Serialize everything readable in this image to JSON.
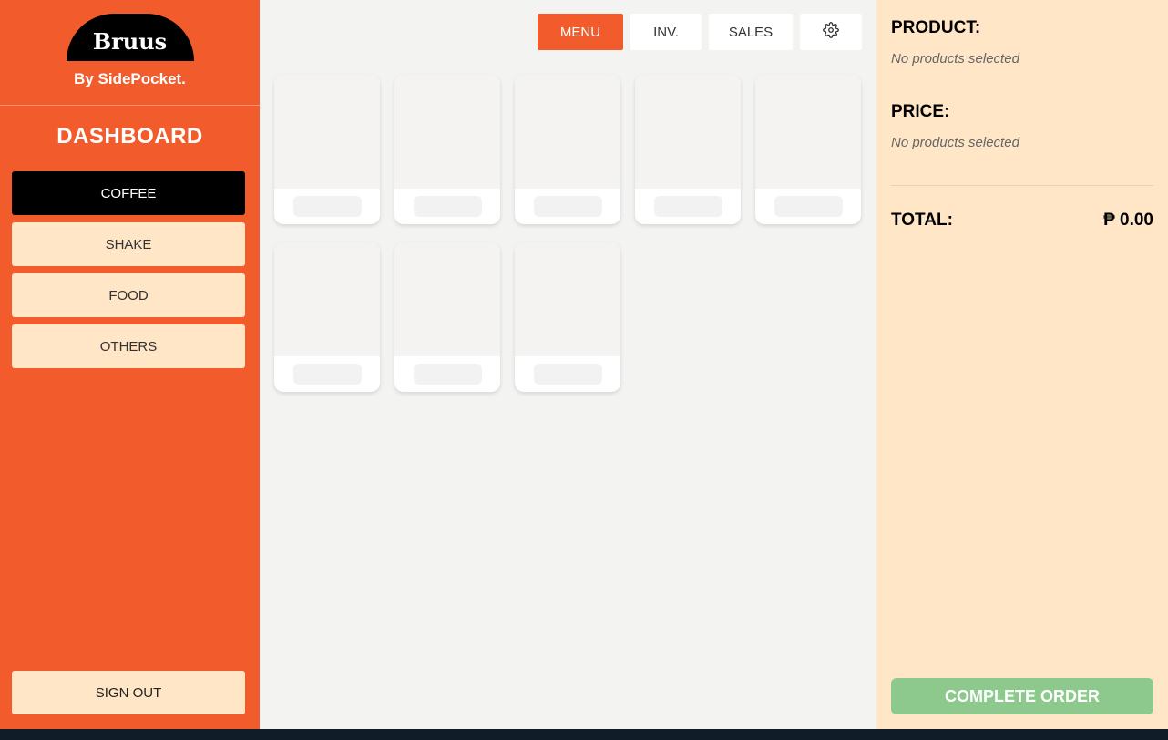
{
  "brand": {
    "name": "Bruus",
    "tagline": "By SidePocket."
  },
  "sidebar": {
    "title": "DASHBOARD",
    "categories": [
      {
        "label": "COFFEE",
        "active": true
      },
      {
        "label": "SHAKE",
        "active": false
      },
      {
        "label": "FOOD",
        "active": false
      },
      {
        "label": "OTHERS",
        "active": false
      }
    ],
    "sign_out": "SIGN OUT"
  },
  "topnav": {
    "menu": "MENU",
    "inventory": "INV.",
    "sales": "SALES",
    "settings_icon": "gear-icon"
  },
  "product_grid": {
    "loading_placeholders": 8
  },
  "order_panel": {
    "product_label": "PRODUCT:",
    "product_value": "No products selected",
    "price_label": "PRICE:",
    "price_value": "No products selected",
    "total_label": "TOTAL:",
    "total_value": "₱ 0.00",
    "complete_button": "COMPLETE ORDER"
  },
  "colors": {
    "accent": "#f25c2c",
    "panel_bg": "#ffe6c7",
    "active_category": "#000000",
    "complete_button": "#8dc98c"
  }
}
